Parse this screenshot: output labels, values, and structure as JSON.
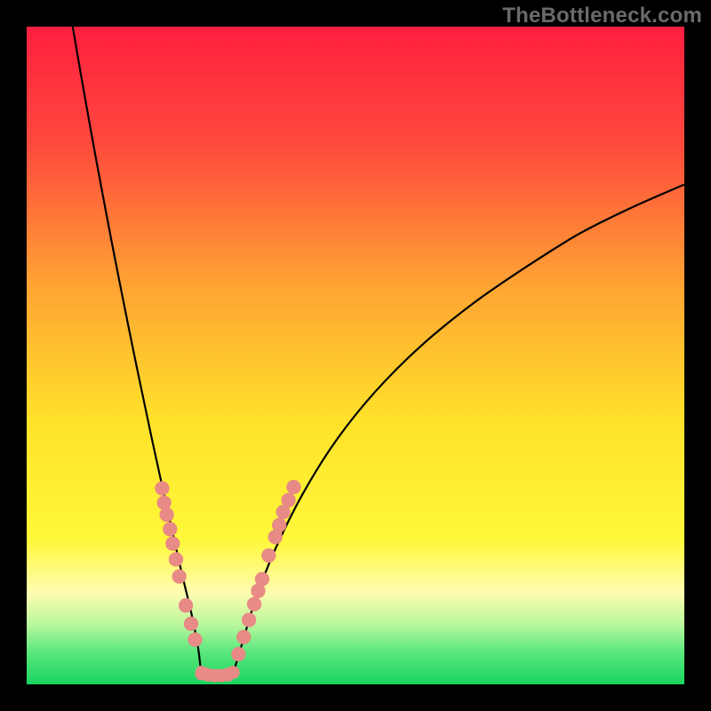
{
  "watermark": "TheBottleneck.com",
  "gradient_stops": [
    {
      "offset": 0.0,
      "color": "#ff1f3f"
    },
    {
      "offset": 0.18,
      "color": "#ff4a3d"
    },
    {
      "offset": 0.4,
      "color": "#ffa633"
    },
    {
      "offset": 0.6,
      "color": "#ffe22a"
    },
    {
      "offset": 0.78,
      "color": "#fff83a"
    },
    {
      "offset": 0.86,
      "color": "#fffcb0"
    },
    {
      "offset": 0.91,
      "color": "#b8f79d"
    },
    {
      "offset": 0.95,
      "color": "#5ce87e"
    },
    {
      "offset": 1.0,
      "color": "#19d45f"
    }
  ],
  "chart_data": {
    "type": "line",
    "title": "",
    "xlabel": "",
    "ylabel": "",
    "xlim": [
      0,
      100
    ],
    "ylim": [
      0,
      100
    ],
    "left_curve_start_x": 7,
    "left_curve_top_y": 100,
    "vertex": {
      "x": 26.5,
      "y": 2
    },
    "right_curve_end": {
      "x": 100,
      "y": 76
    },
    "series": [
      {
        "name": "left-arm",
        "type": "line",
        "points": [
          [
            7.0,
            100.0
          ],
          [
            8.2,
            93.0
          ],
          [
            9.4,
            86.2
          ],
          [
            10.6,
            79.6
          ],
          [
            11.8,
            73.2
          ],
          [
            13.0,
            66.9
          ],
          [
            14.2,
            60.8
          ],
          [
            15.4,
            54.8
          ],
          [
            16.6,
            48.9
          ],
          [
            17.8,
            43.2
          ],
          [
            19.0,
            37.5
          ],
          [
            20.2,
            32.0
          ],
          [
            21.4,
            26.6
          ],
          [
            22.6,
            21.2
          ],
          [
            23.8,
            16.0
          ],
          [
            25.0,
            11.0
          ],
          [
            26.0,
            6.0
          ],
          [
            26.5,
            2.0
          ]
        ]
      },
      {
        "name": "floor",
        "type": "line",
        "points": [
          [
            26.5,
            2.0
          ],
          [
            28.0,
            1.5
          ],
          [
            30.0,
            1.5
          ],
          [
            31.5,
            2.0
          ]
        ]
      },
      {
        "name": "right-arm",
        "type": "line",
        "points": [
          [
            31.5,
            2.0
          ],
          [
            33.0,
            7.0
          ],
          [
            35.0,
            13.5
          ],
          [
            38.0,
            21.0
          ],
          [
            42.0,
            29.0
          ],
          [
            47.0,
            37.0
          ],
          [
            53.0,
            44.5
          ],
          [
            60.0,
            51.5
          ],
          [
            68.0,
            58.0
          ],
          [
            76.0,
            63.5
          ],
          [
            84.0,
            68.5
          ],
          [
            92.0,
            72.5
          ],
          [
            100.0,
            76.0
          ]
        ]
      }
    ],
    "dots": {
      "color": "#e88a85",
      "radius": 1.1,
      "left_arm": [
        [
          20.6,
          29.8
        ],
        [
          20.9,
          27.6
        ],
        [
          21.3,
          25.8
        ],
        [
          21.8,
          23.6
        ],
        [
          22.2,
          21.4
        ],
        [
          22.7,
          19.0
        ],
        [
          23.2,
          16.4
        ],
        [
          24.2,
          12.0
        ],
        [
          25.0,
          9.2
        ],
        [
          25.6,
          6.8
        ]
      ],
      "floor": [
        [
          26.6,
          1.6
        ],
        [
          27.6,
          1.4
        ],
        [
          28.6,
          1.3
        ],
        [
          29.6,
          1.3
        ],
        [
          30.6,
          1.4
        ],
        [
          31.4,
          1.8
        ]
      ],
      "right_arm": [
        [
          32.2,
          4.6
        ],
        [
          33.0,
          7.2
        ],
        [
          33.8,
          9.8
        ],
        [
          34.6,
          12.2
        ],
        [
          35.2,
          14.2
        ],
        [
          35.8,
          16.0
        ],
        [
          36.8,
          19.6
        ],
        [
          37.8,
          22.4
        ],
        [
          38.4,
          24.2
        ],
        [
          39.0,
          26.2
        ],
        [
          39.8,
          28.0
        ],
        [
          40.6,
          30.0
        ]
      ]
    }
  }
}
